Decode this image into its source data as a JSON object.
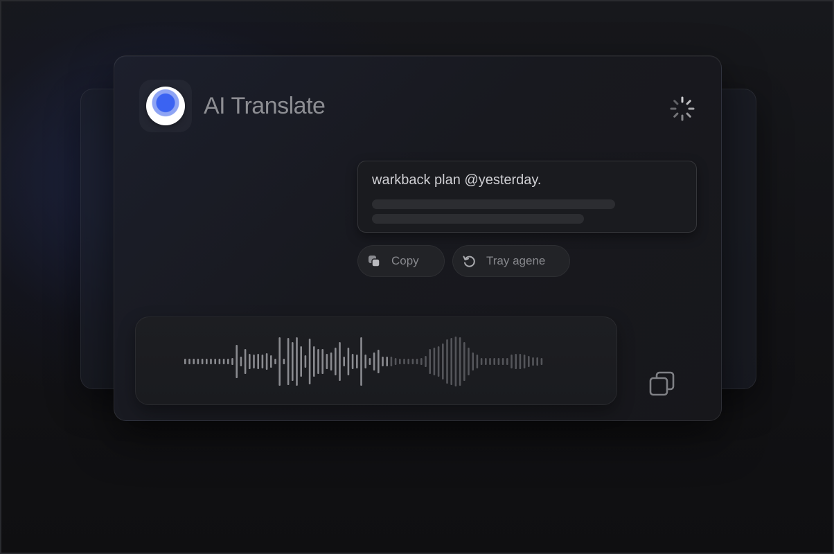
{
  "app": {
    "title": "AI Translate"
  },
  "result": {
    "text": "warkback plan @yesterday."
  },
  "actions": {
    "copy_label": "Copy",
    "retry_label": "Tray agene"
  },
  "icons": {
    "app": "app-logo-icon",
    "loading": "loading-spinner-icon",
    "copy": "copy-icon",
    "retry": "retry-icon",
    "corner_copy": "duplicate-icon"
  },
  "colors": {
    "accent": "#3b63f2",
    "text_primary": "#cfcfd3",
    "text_muted": "#8d8e93",
    "card_bg": "#18191f"
  }
}
